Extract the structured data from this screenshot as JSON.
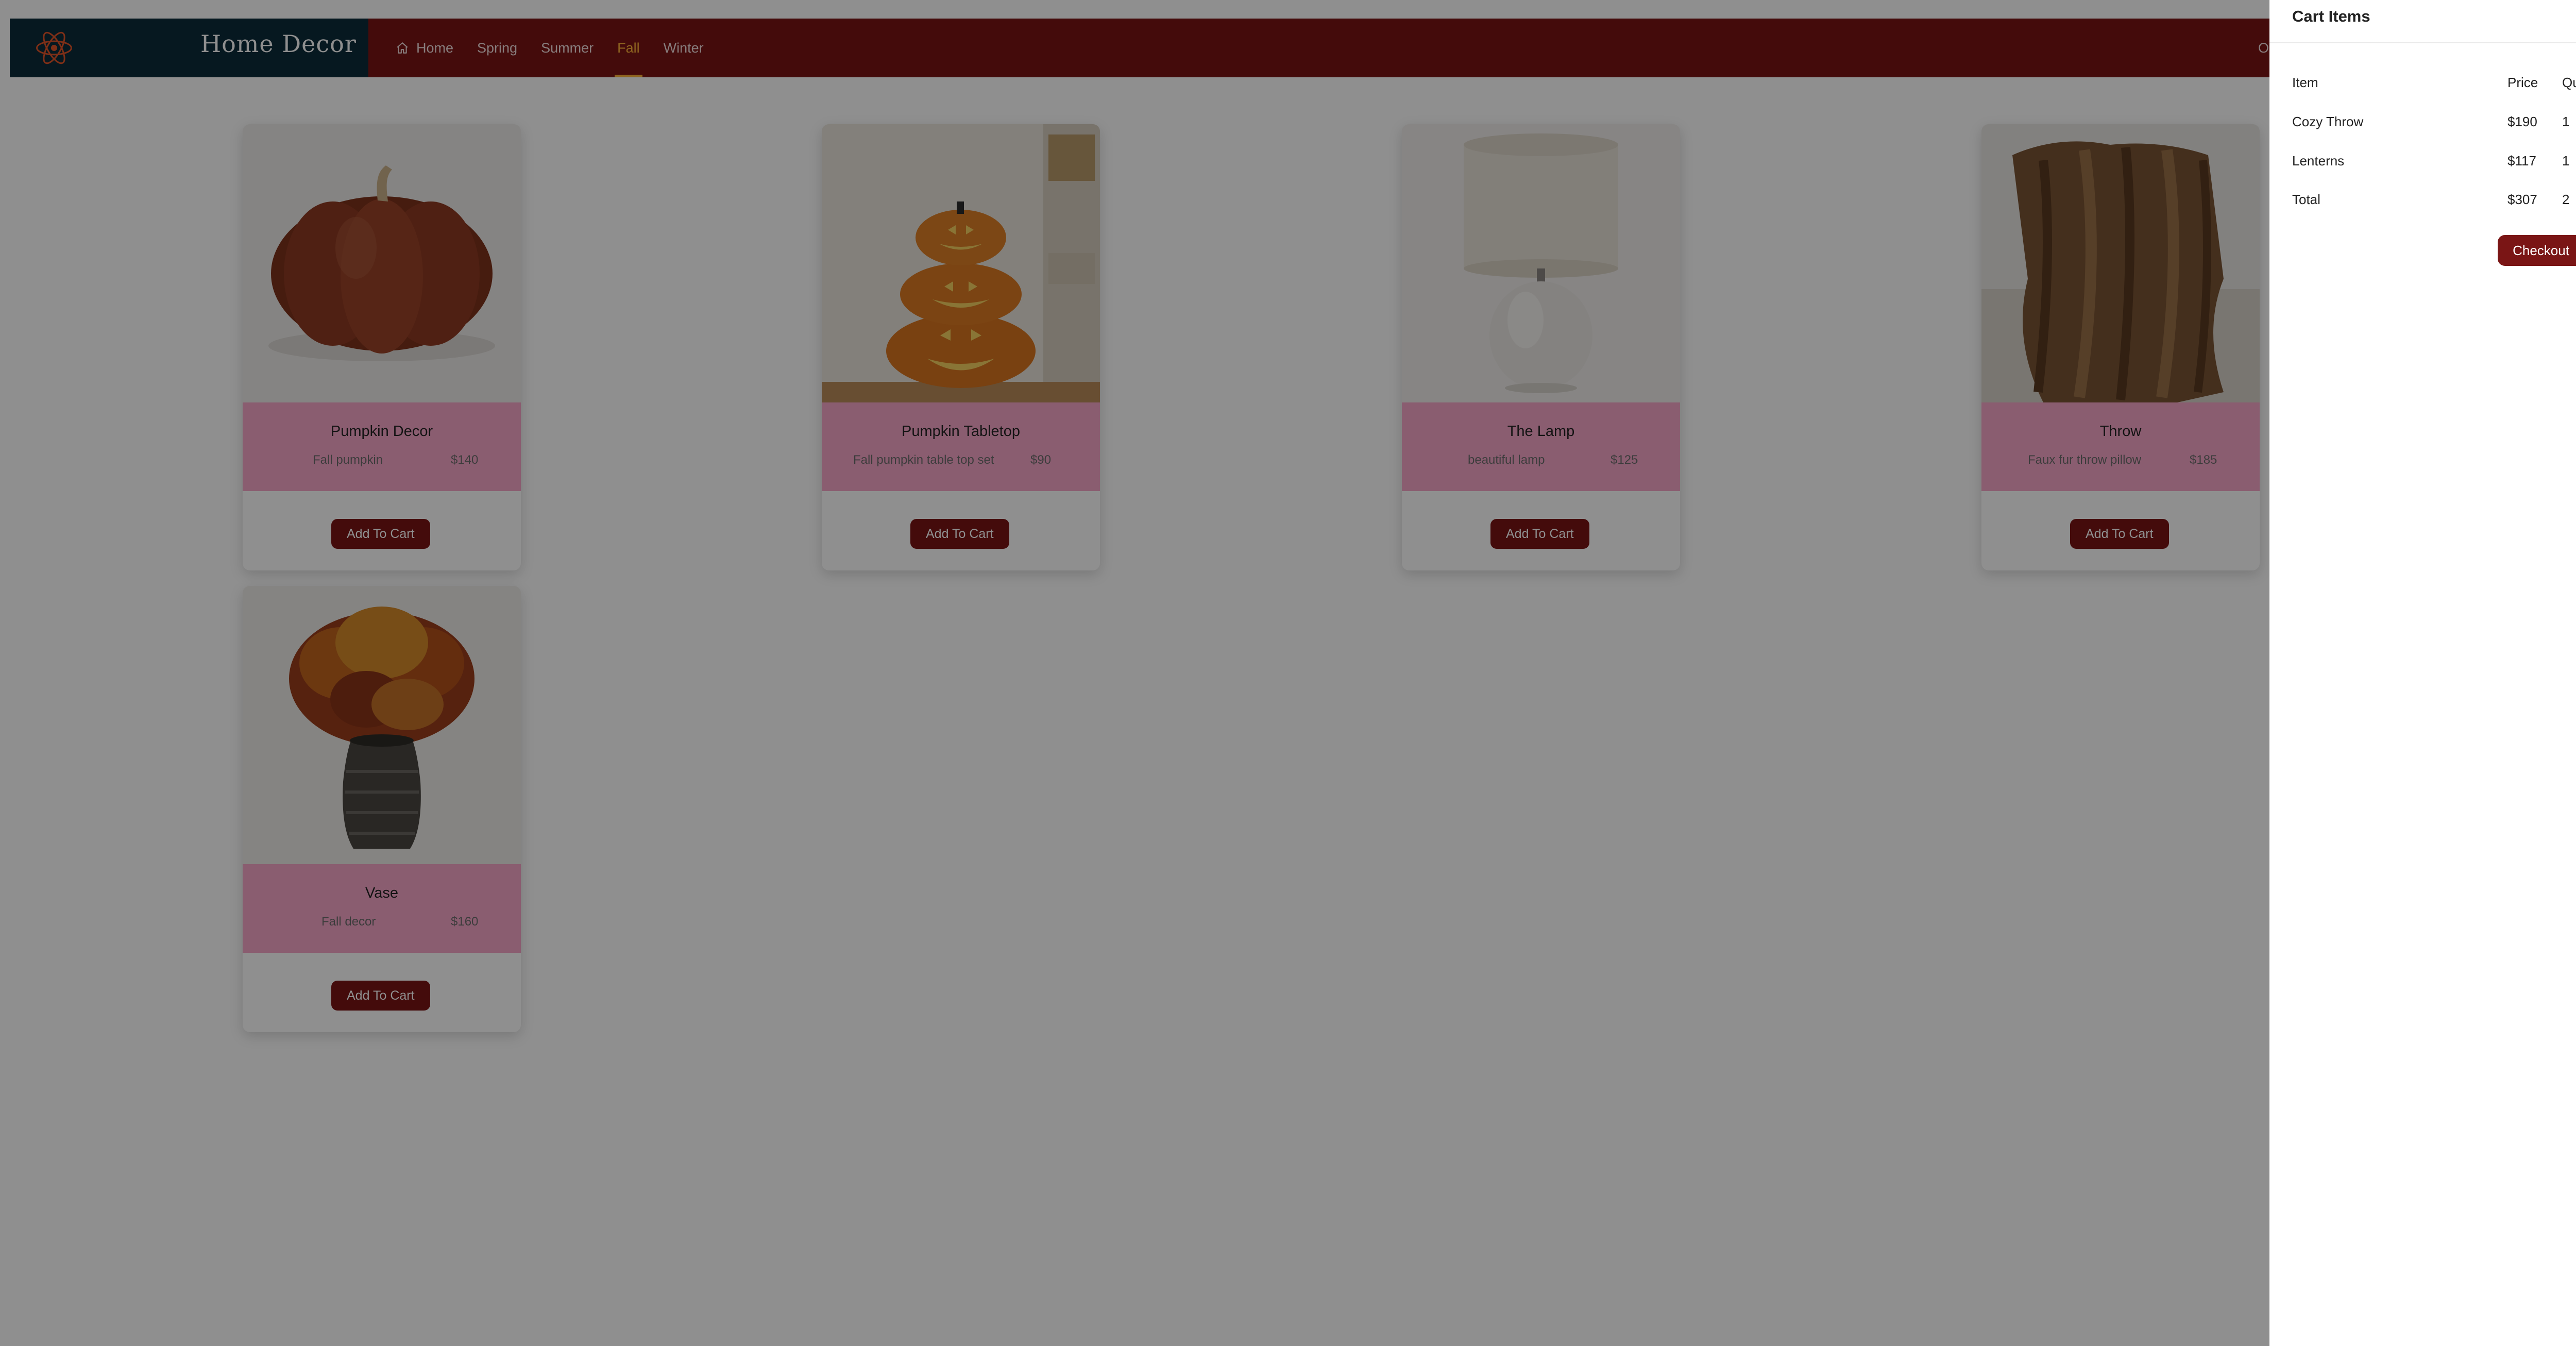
{
  "brand": {
    "name": "Home Decor",
    "logo_icon": "atom-logo-icon"
  },
  "nav": {
    "items": [
      {
        "label": "Home",
        "icon": "home-icon",
        "active": false
      },
      {
        "label": "Spring",
        "active": false
      },
      {
        "label": "Summer",
        "active": false
      },
      {
        "label": "Fall",
        "active": true
      },
      {
        "label": "Winter",
        "active": false
      }
    ],
    "right_label_partial": "Ord"
  },
  "products": [
    {
      "title": "Pumpkin Decor",
      "description": "Fall pumpkin",
      "price": "$140",
      "button": "Add To Cart",
      "image": "brown-pumpkin"
    },
    {
      "title": "Pumpkin Tabletop",
      "description": "Fall pumpkin table top set",
      "price": "$90",
      "button": "Add To Cart",
      "image": "stacked-jack-o-lanterns"
    },
    {
      "title": "The Lamp",
      "description": "beautiful lamp",
      "price": "$125",
      "button": "Add To Cart",
      "image": "white-table-lamp"
    },
    {
      "title": "Throw",
      "description": "Faux fur throw pillow",
      "price": "$185",
      "button": "Add To Cart",
      "image": "faux-fur-throw"
    },
    {
      "title": "Vase",
      "description": "Fall decor",
      "price": "$160",
      "button": "Add To Cart",
      "image": "autumn-flower-vase"
    }
  ],
  "cart": {
    "title": "Cart Items",
    "headers": {
      "item": "Item",
      "price": "Price",
      "quantity": "Quantity"
    },
    "rows": [
      {
        "item": "Cozy Throw",
        "price": "$190",
        "quantity": "1"
      },
      {
        "item": "Lenterns",
        "price": "$117",
        "quantity": "1"
      }
    ],
    "total": {
      "label": "Total",
      "price": "$307",
      "quantity": "2"
    },
    "checkout_label": "Checkout"
  },
  "colors": {
    "accent": "#7a1515",
    "brand_bg": "#0b2b3a",
    "card_info_bg": "#f7a7c8",
    "active_nav": "#ffb43a",
    "logo": "#e0552a"
  }
}
